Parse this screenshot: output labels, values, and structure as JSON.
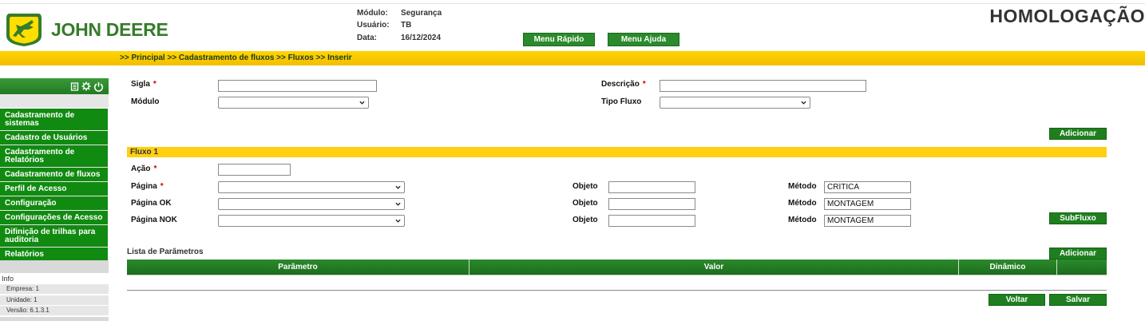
{
  "header": {
    "brand": "JOHN DEERE",
    "environment": "HOMOLOGAÇÃO",
    "modulo_label": "Módulo:",
    "modulo_value": "Segurança",
    "usuario_label": "Usuário:",
    "usuario_value": "TB",
    "data_label": "Data:",
    "data_value": "16/12/2024",
    "menu_rapido": "Menu Rápido",
    "menu_ajuda": "Menu Ajuda"
  },
  "breadcrumb": ">> Principal  >> Cadastramento de fluxos  >> Fluxos  >> Inserir",
  "sidebar": {
    "items": [
      "Cadastramento de sistemas",
      "Cadastro de Usuários",
      "Cadastramento de Relatórios",
      "Cadastramento de fluxos",
      "Perfil de Acesso",
      "Configuração",
      "Configurações de Acesso",
      "Difinição de trilhas para auditoria",
      "Relatórios"
    ],
    "info_title": "Info",
    "info": [
      "Empresa: 1",
      "Unidade: 1",
      "Versão: 6.1.3.1"
    ]
  },
  "form": {
    "sigla_label": "Sigla",
    "descricao_label": "Descrição",
    "modulo_label": "Módulo",
    "tipo_fluxo_label": "Tipo Fluxo",
    "required_mark": "*",
    "adicionar": "Adicionar"
  },
  "fluxo": {
    "title": "Fluxo 1",
    "acao_label": "Ação",
    "pagina_label": "Página",
    "pagina_ok_label": "Página OK",
    "pagina_nok_label": "Página NOK",
    "objeto_label": "Objeto",
    "metodo_label": "Método",
    "metodo_values": [
      "CRÍTICA",
      "MONTAGEM",
      "MONTAGEM"
    ],
    "subfluxo": "SubFluxo"
  },
  "parametros": {
    "title": "Lista de Parâmetros",
    "adicionar": "Adicionar",
    "columns": [
      "Parâmetro",
      "Valor",
      "Dinâmico"
    ]
  },
  "actions": {
    "voltar": "Voltar",
    "salvar": "Salvar"
  },
  "colors": {
    "brand_green": "#367c2b",
    "menu_green": "#118a11",
    "accent_yellow": "#ffcf12"
  }
}
